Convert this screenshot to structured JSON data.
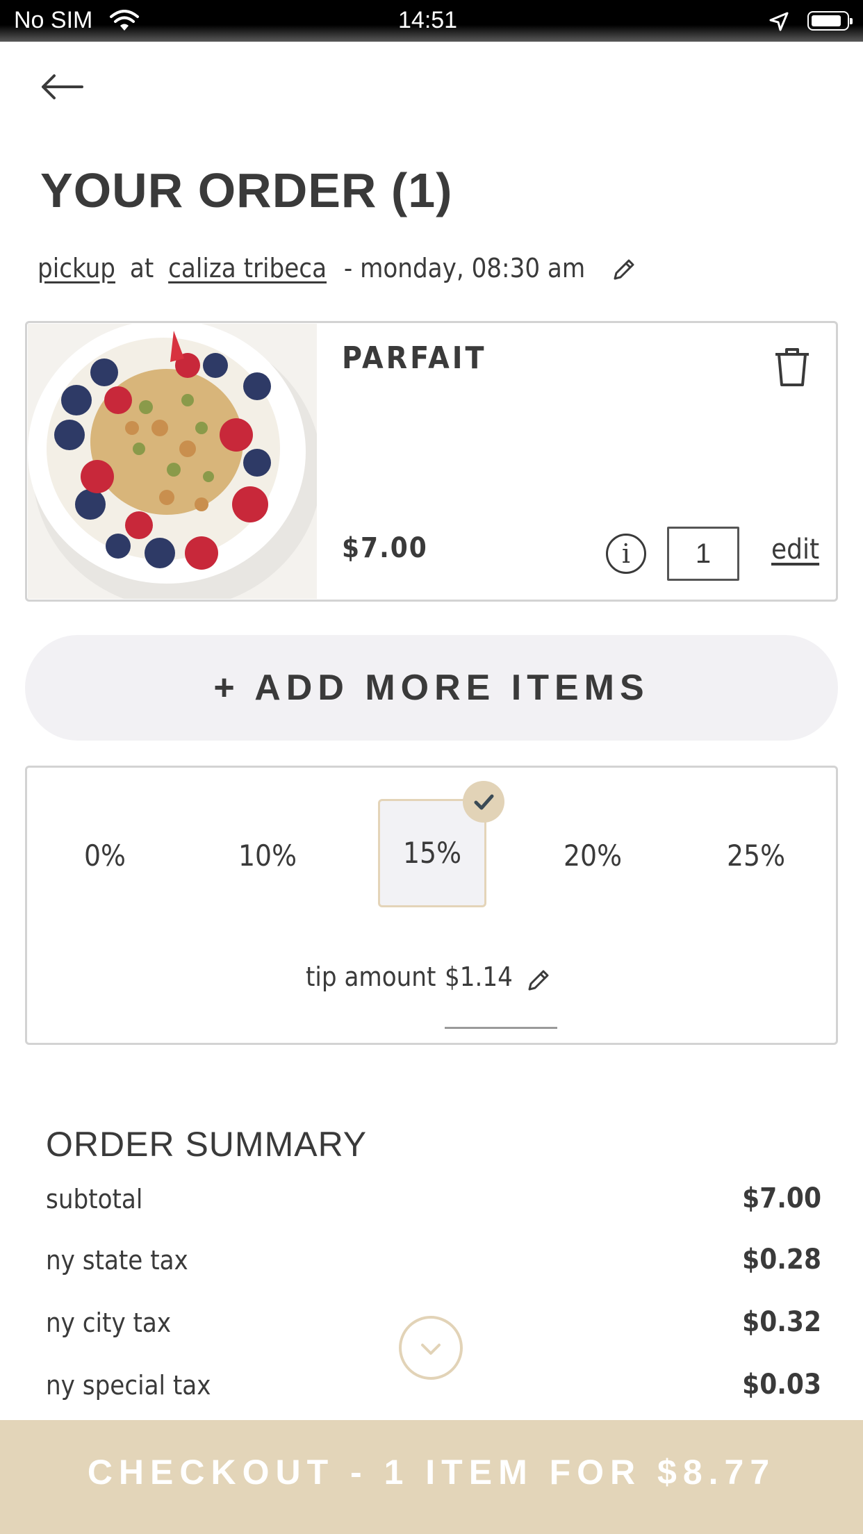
{
  "status_bar": {
    "carrier": "No SIM",
    "time": "14:51"
  },
  "header": {
    "back_icon": "arrow-left-icon"
  },
  "title": "YOUR ORDER (1)",
  "pickup": {
    "mode": "pickup",
    "at": "at",
    "location": "caliza tribeca",
    "when": "- monday, 08:30 am"
  },
  "item": {
    "name": "PARFAIT",
    "price": "$7.00",
    "info": "i",
    "quantity": "1",
    "edit": "edit"
  },
  "add_more": "+ ADD MORE ITEMS",
  "tip": {
    "options": [
      "0%",
      "10%",
      "15%",
      "20%",
      "25%"
    ],
    "selected": "15%",
    "label": "tip amount",
    "amount": "$1.14"
  },
  "summary": {
    "title": "ORDER SUMMARY",
    "rows": [
      {
        "label": "subtotal",
        "value": "$7.00"
      },
      {
        "label": "ny state tax",
        "value": "$0.28"
      },
      {
        "label": "ny city tax",
        "value": "$0.32"
      },
      {
        "label": "ny special tax",
        "value": "$0.03"
      }
    ]
  },
  "checkout": "CHECKOUT - 1 ITEM FOR $8.77",
  "colors": {
    "accent": "#e3d5b9",
    "text": "#3a3a3a",
    "border": "#d3d3d3",
    "button_bg": "#f2f1f4"
  }
}
